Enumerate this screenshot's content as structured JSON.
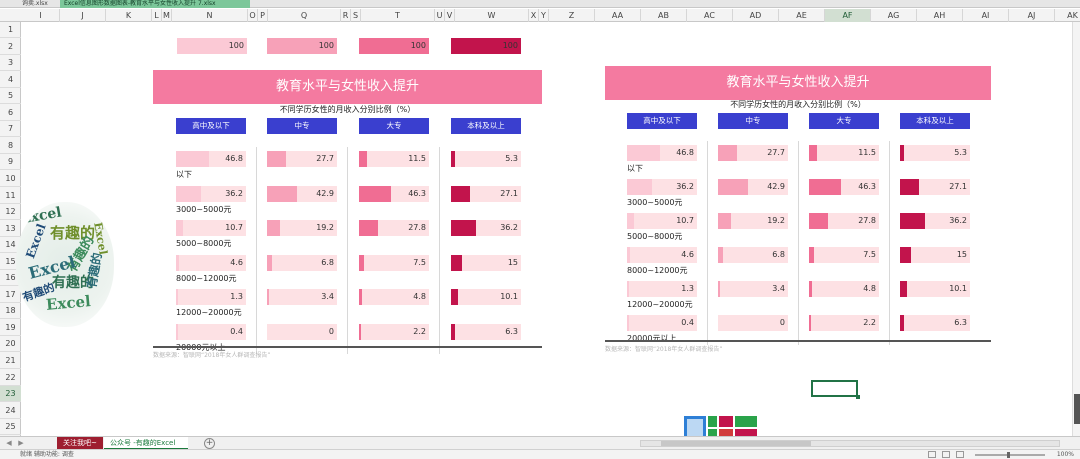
{
  "window": {
    "doc_tabs": [
      "询卖.xlsx",
      "Excel信息图形数据图表-教育水平与女性收入提升 7.xlsx"
    ]
  },
  "columns": [
    "I",
    "J",
    "K",
    "L",
    "M",
    "N",
    "O",
    "P",
    "Q",
    "R",
    "S",
    "T",
    "U",
    "V",
    "W",
    "X",
    "Y",
    "Z",
    "AA",
    "AB",
    "AC",
    "AD",
    "AE",
    "AF",
    "AG",
    "AH",
    "AI",
    "AJ",
    "AK"
  ],
  "selected_column": "AF",
  "rows": [
    "1",
    "2",
    "3",
    "4",
    "5",
    "6",
    "7",
    "8",
    "9",
    "10",
    "11",
    "12",
    "13",
    "14",
    "15",
    "16",
    "17",
    "18",
    "19",
    "20",
    "21",
    "22",
    "23",
    "24",
    "25"
  ],
  "selected_row": "23",
  "reference_row": {
    "values": [
      "100",
      "100",
      "100",
      "100"
    ],
    "colors": [
      "#fbc9d5",
      "#f7a1b8",
      "#f06d93",
      "#c2144c"
    ]
  },
  "panel": {
    "title": "教育水平与女性收入提升",
    "subtitle": "不同学历女性的月收入分别比例（%）",
    "source": "数据来源：智联网“2018年女人群调查报告”",
    "title_color": "#f47aa0",
    "header_color": "#3a3fcf",
    "headers": [
      "高中及以下",
      "中专",
      "大专",
      "本科及以上"
    ],
    "series_colors": [
      "#fbc9d5",
      "#f7a1b8",
      "#f06d93",
      "#c2144c"
    ],
    "rows": [
      {
        "label": "以下",
        "values": [
          46.8,
          27.7,
          11.5,
          5.3
        ],
        "display": [
          "46.8",
          "27.7",
          "11.5",
          "5.3"
        ]
      },
      {
        "label": "3000~5000元",
        "values": [
          36.2,
          42.9,
          46.3,
          27.1
        ],
        "display": [
          "36.2",
          "42.9",
          "46.3",
          "27.1"
        ]
      },
      {
        "label": "5000~8000元",
        "values": [
          10.7,
          19.2,
          27.8,
          36.2
        ],
        "display": [
          "10.7",
          "19.2",
          "27.8",
          "36.2"
        ]
      },
      {
        "label": "8000~12000元",
        "values": [
          4.6,
          6.8,
          7.5,
          15
        ],
        "display": [
          "4.6",
          "6.8",
          "7.5",
          "15"
        ]
      },
      {
        "label": "12000~20000元",
        "values": [
          1.3,
          3.4,
          4.8,
          10.1
        ],
        "display": [
          "1.3",
          "3.4",
          "4.8",
          "10.1"
        ]
      },
      {
        "label": "20000元以上",
        "values": [
          0.4,
          0,
          2.2,
          6.3
        ],
        "display": [
          "0.4",
          "0",
          "2.2",
          "6.3"
        ]
      }
    ]
  },
  "wordcloud": {
    "words": [
      "Excel",
      "有趣的",
      "Excel",
      "有趣的",
      "Excel",
      "有趣的",
      "Excel",
      "有趣的",
      "Excel",
      "有趣的"
    ],
    "colors": [
      "#2e6f52",
      "#6f8f2b",
      "#1f4b77",
      "#3c8b5c",
      "#2b6c78"
    ]
  },
  "sheets": [
    {
      "label": "关注我吧~",
      "active": false
    },
    {
      "label": "公众号 -有趣的Excel",
      "active": true
    }
  ],
  "status": {
    "left": "就绪  辅助功能: 调查",
    "zoom": "100%"
  },
  "qr_colors": [
    "#2e7fd6",
    "#2aa34a",
    "#c2144c",
    "#d13b3b"
  ]
}
